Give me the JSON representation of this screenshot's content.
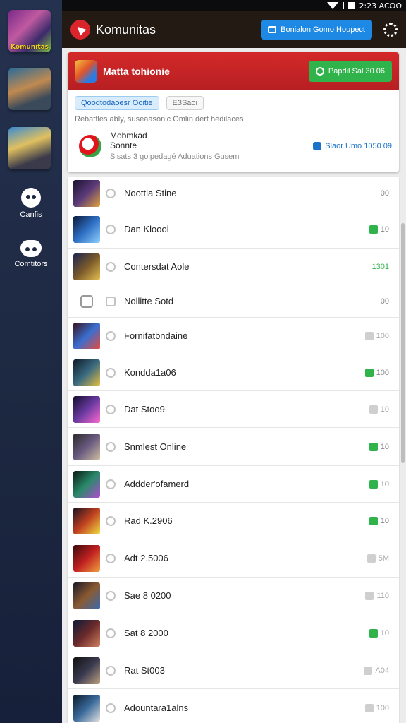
{
  "status_bar": {
    "time": "2:23 ACOO"
  },
  "sidebar": {
    "games": [
      {
        "caption": "Komunitas"
      },
      {
        "caption": ""
      },
      {
        "caption": ""
      }
    ],
    "nav": [
      {
        "label": "Canfis",
        "icon": "gamepad-icon"
      },
      {
        "label": "Comtitors",
        "icon": "community-icon"
      }
    ]
  },
  "topbar": {
    "title": "Komunitas",
    "button_label": "Bonialon Gomo Houpect"
  },
  "featured": {
    "title": "Matta tohionie",
    "play_label": "Papdil Sal 30 06",
    "chips": [
      "Qoodtodaoesr Ooitie",
      "E3Saoi"
    ],
    "description": "Rebatfles ably, suseaasonic Omlin dert hedilaces",
    "profile_name_1": "Mobmkad",
    "profile_name_2": "Sonnte",
    "profile_sub": "Sisats 3 goipedagé Aduations Gusem",
    "verified_label": "Slaor Umo 1050 09"
  },
  "rows": [
    {
      "name": "Noottla Stine",
      "stat": "00",
      "stat_type": "plain",
      "gradient": "linear-gradient(135deg,#1a1230,#5b3a7a,#e0a43a)"
    },
    {
      "name": "Dan Kloool",
      "stat": "10",
      "stat_type": "green",
      "gradient": "linear-gradient(135deg,#0b1a3a,#2e6fc4,#8fd0ff)"
    },
    {
      "name": "Contersdat Aole",
      "stat": "1301",
      "stat_type": "green-text",
      "gradient": "linear-gradient(135deg,#1b2450,#7a5a2a,#e6c050)"
    },
    {
      "name": "Nollitte Sotd",
      "stat": "00",
      "stat_type": "plain",
      "gradient": "small"
    },
    {
      "name": "Fornifatbndaine",
      "stat": "100",
      "stat_type": "grey",
      "gradient": "linear-gradient(135deg,#3a0f1a,#3a6fd0,#e84a3a)"
    },
    {
      "name": "Kondda1a06",
      "stat": "100",
      "stat_type": "green",
      "gradient": "linear-gradient(135deg,#0e1a2a,#3a6a80,#e8c040)"
    },
    {
      "name": "Dat Stoo9",
      "stat": "10",
      "stat_type": "grey",
      "gradient": "linear-gradient(135deg,#140d2e,#6a3aa0,#ff6ad0)"
    },
    {
      "name": "Snmlest Online",
      "stat": "10",
      "stat_type": "green",
      "gradient": "linear-gradient(135deg,#2a2a2a,#6a5a80,#d0c0a0)"
    },
    {
      "name": "Addder'ofamerd",
      "stat": "10",
      "stat_type": "green",
      "gradient": "linear-gradient(135deg,#0a1a14,#2a8a6a,#b04ad0)"
    },
    {
      "name": "Rad K.2906",
      "stat": "10",
      "stat_type": "green",
      "gradient": "linear-gradient(135deg,#1a1020,#c04020,#f0e040)"
    },
    {
      "name": "Adt 2.5006",
      "stat": "5M",
      "stat_type": "grey",
      "gradient": "linear-gradient(135deg,#3a0a0a,#c02020,#f0a040)"
    },
    {
      "name": "Sae 8 0200",
      "stat": "110",
      "stat_type": "grey",
      "gradient": "linear-gradient(135deg,#1a1a2a,#8a5a30,#3a6ab0)"
    },
    {
      "name": "Sat 8 2000",
      "stat": "10",
      "stat_type": "green",
      "gradient": "linear-gradient(135deg,#0a1a3a,#6a2a2a,#d08060)"
    },
    {
      "name": "Rat St003",
      "stat": "A04",
      "stat_type": "grey",
      "gradient": "linear-gradient(135deg,#101010,#3a3a50,#c0a080)"
    },
    {
      "name": "Adountara1alns",
      "stat": "100",
      "stat_type": "grey",
      "gradient": "linear-gradient(135deg,#0a1a2a,#3a6a9a,#e0e0e0)"
    }
  ]
}
